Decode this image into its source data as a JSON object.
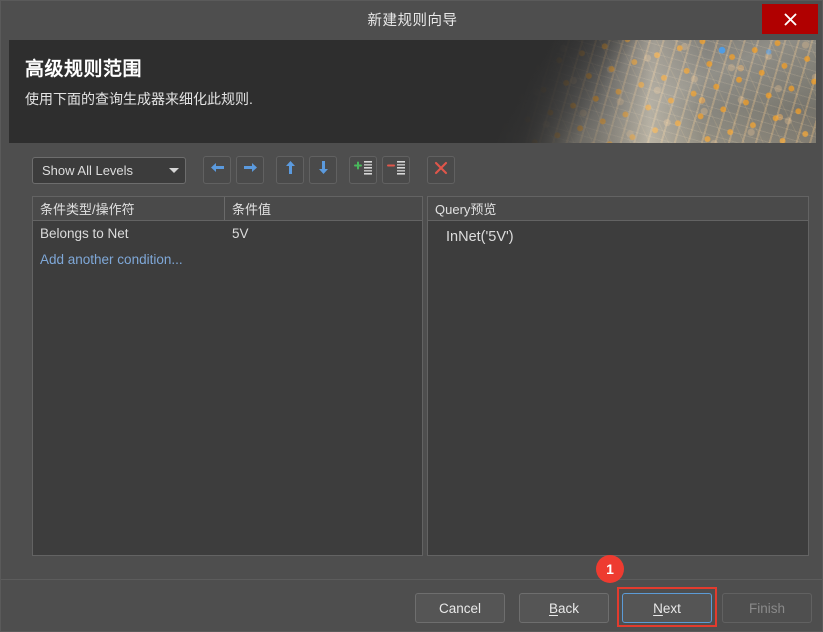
{
  "window": {
    "title": "新建规则向导",
    "close_icon": "close-icon"
  },
  "banner": {
    "title": "高级规则范围",
    "subtitle": "使用下面的查询生成器来细化此规则."
  },
  "toolbar": {
    "level_filter": {
      "selected": "Show All Levels",
      "caret_icon": "chevron-down-icon"
    },
    "buttons": [
      {
        "name": "move-left-button",
        "icon": "arrow-left-icon"
      },
      {
        "name": "move-right-button",
        "icon": "arrow-right-icon"
      },
      {
        "name": "move-up-button",
        "icon": "arrow-up-icon"
      },
      {
        "name": "move-down-button",
        "icon": "arrow-down-icon"
      },
      {
        "name": "add-condition-button",
        "icon": "add-list-icon"
      },
      {
        "name": "remove-condition-button",
        "icon": "remove-list-icon"
      },
      {
        "name": "clear-all-button",
        "icon": "red-x-icon"
      }
    ]
  },
  "conditions_panel": {
    "columns": [
      "条件类型/操作符",
      "条件值"
    ],
    "rows": [
      {
        "type": "Belongs to Net",
        "value": "5V"
      }
    ],
    "add_row_label": "Add another condition..."
  },
  "query_panel": {
    "header": "Query预览",
    "text": "InNet('5V')"
  },
  "footer": {
    "cancel": "Cancel",
    "back_prefix": "",
    "back_accel": "B",
    "back_rest": "ack",
    "next_accel": "N",
    "next_rest": "ext",
    "finish": "Finish"
  },
  "annotation": {
    "badge_number": "1"
  },
  "colors": {
    "accent_red": "#ee3b30",
    "highlight_red": "#e23b2e",
    "focus_blue": "#5c9bd6",
    "link_blue": "#7fa8d8",
    "close_red": "#b00000"
  }
}
